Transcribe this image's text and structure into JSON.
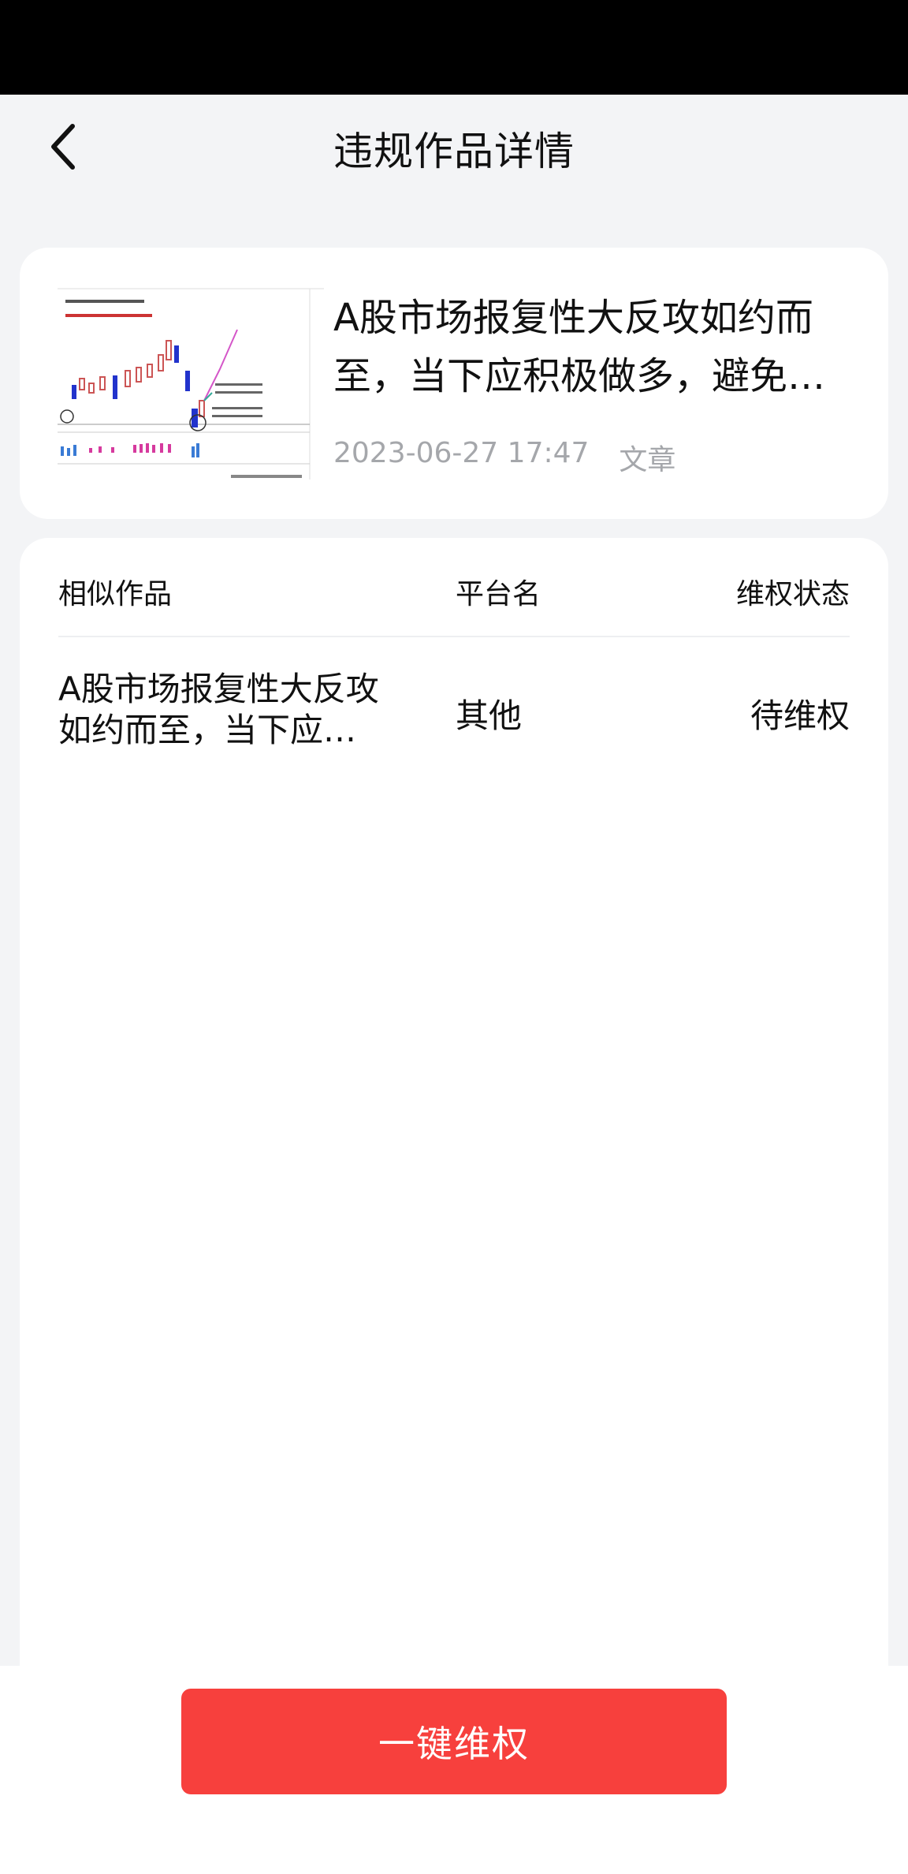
{
  "header": {
    "title": "违规作品详情",
    "back_icon": "chevron-left-icon"
  },
  "work": {
    "title": "A股市场报复性大反攻如约而至，当下应积极做多，避免…",
    "date": "2023-06-27 17:47",
    "type": "文章",
    "thumbnail_icon": "stock-chart-thumbnail"
  },
  "table": {
    "headers": {
      "work": "相似作品",
      "platform": "平台名",
      "status": "维权状态"
    },
    "rows": [
      {
        "work": "A股市场报复性大反攻如约而至，当下应…",
        "platform": "其他",
        "status": "待维权"
      }
    ]
  },
  "footer": {
    "action_label": "一键维权"
  },
  "colors": {
    "accent": "#f7403d",
    "background": "#f3f4f6",
    "meta_text": "#a5a7ab"
  }
}
